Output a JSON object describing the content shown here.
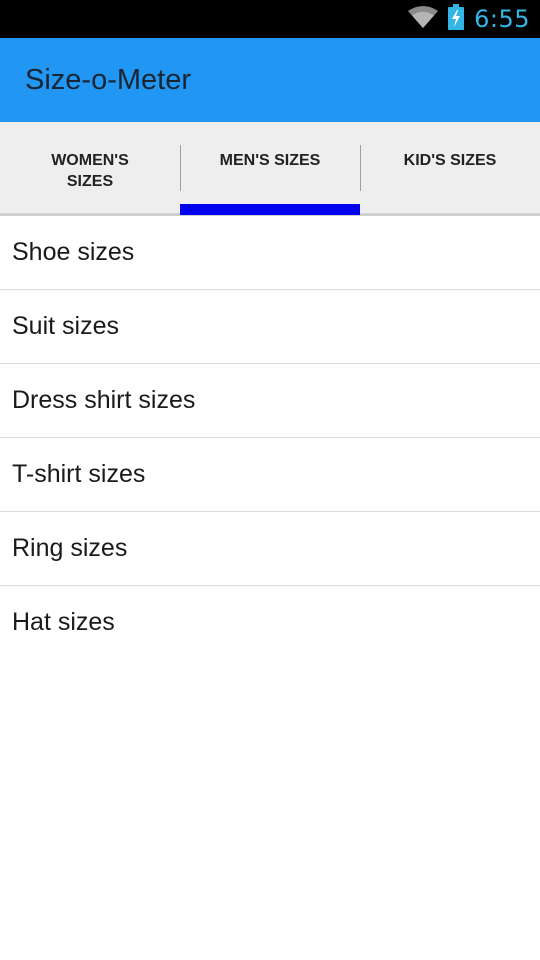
{
  "status_bar": {
    "time": "6:55",
    "icons": [
      "wifi-icon",
      "battery-charging-icon"
    ],
    "clock_color": "#33b5e5"
  },
  "app_bar": {
    "title": "Size-o-Meter",
    "color": "#2196f3"
  },
  "tabs": [
    {
      "label_line1": "WOMEN'S",
      "label_line2": "SIZES",
      "selected": false
    },
    {
      "label_line1": "MEN'S SIZES",
      "label_line2": "",
      "selected": true
    },
    {
      "label_line1": "KID'S SIZES",
      "label_line2": "",
      "selected": false
    }
  ],
  "tab_indicator_color": "#0000ee",
  "list": {
    "items": [
      {
        "label": "Shoe sizes"
      },
      {
        "label": "Suit sizes"
      },
      {
        "label": "Dress shirt sizes"
      },
      {
        "label": "T-shirt sizes"
      },
      {
        "label": "Ring sizes"
      },
      {
        "label": "Hat sizes"
      }
    ]
  }
}
